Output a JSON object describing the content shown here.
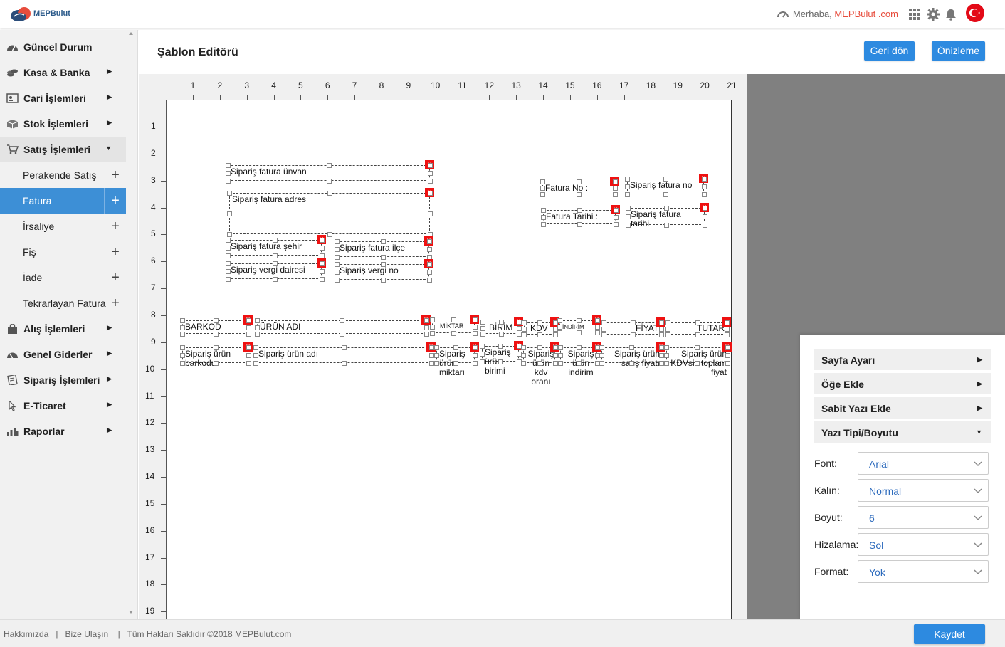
{
  "app": {
    "logo_text": "MEPBulut",
    "greeting": "Merhaba,",
    "user": "MEPBulut .com"
  },
  "sidebar": {
    "items": [
      {
        "label": "Güncel Durum",
        "icon": "dashboard-icon",
        "arrow": ""
      },
      {
        "label": "Kasa & Banka",
        "icon": "coins-icon",
        "arrow": "▶"
      },
      {
        "label": "Cari İşlemleri",
        "icon": "contact-card-icon",
        "arrow": "▶"
      },
      {
        "label": "Stok İşlemleri",
        "icon": "box-icon",
        "arrow": "▶"
      },
      {
        "label": "Satış İşlemleri",
        "icon": "cart-icon",
        "arrow": "▼"
      }
    ],
    "sub_items": [
      {
        "label": "Perakende Satış",
        "plus": "+"
      },
      {
        "label": "Fatura",
        "plus": "+"
      },
      {
        "label": "İrsaliye",
        "plus": "+"
      },
      {
        "label": "Fiş",
        "plus": "+"
      },
      {
        "label": "İade",
        "plus": "+"
      },
      {
        "label": "Tekrarlayan Fatura",
        "plus": "+"
      }
    ],
    "items2": [
      {
        "label": "Alış İşlemleri",
        "icon": "bag-icon",
        "arrow": "▶"
      },
      {
        "label": "Genel Giderler",
        "icon": "gauge-icon",
        "arrow": "▶"
      },
      {
        "label": "Sipariş İşlemleri",
        "icon": "document-icon",
        "arrow": "▶"
      },
      {
        "label": "E-Ticaret",
        "icon": "cursor-icon",
        "arrow": "▶"
      },
      {
        "label": "Raporlar",
        "icon": "bar-chart-icon",
        "arrow": "▶"
      }
    ]
  },
  "header": {
    "title": "Şablon Editörü",
    "back_label": "Geri dön",
    "preview_label": "Önizleme"
  },
  "ruler": {
    "top": [
      "1",
      "2",
      "3",
      "4",
      "5",
      "6",
      "7",
      "8",
      "9",
      "10",
      "11",
      "12",
      "13",
      "14",
      "15",
      "16",
      "17",
      "18",
      "19",
      "20",
      "21"
    ],
    "left": [
      "1",
      "2",
      "3",
      "4",
      "5",
      "6",
      "7",
      "8",
      "9",
      "10",
      "11",
      "12",
      "13",
      "14",
      "15",
      "16",
      "17",
      "18",
      "19"
    ]
  },
  "fields": {
    "unvan": "Sipariş fatura ünvan",
    "adres": "Sipariş fatura adres",
    "sehir": "Sipariş fatura şehir",
    "ilce": "Sipariş fatura ilçe",
    "vergi_dairesi": "Sipariş vergi dairesi",
    "vergi_no": "Sipariş vergi no",
    "fatura_no_label": "Fatura No :",
    "fatura_no": "Sipariş fatura no",
    "fatura_tarihi_label": "Fatura Tarihi :",
    "fatura_tarihi": "Sipariş fatura tarihi",
    "barkod": "BARKOD",
    "urun_adi": "ÜRÜN ADI",
    "miktar": "MİKTAR",
    "birim": "BİRİM",
    "kdv": "KDV",
    "indirim": "İNDİRİM",
    "fiyat": "FİYAT",
    "tutar": "TUTAR",
    "urun_barkodu": "Sipariş ürün barkodu",
    "urun_adi_val": "Sipariş ürün adı",
    "urun_miktari": "Sipariş ürün miktarı",
    "urun_birimi": "Sipariş ürün birimi",
    "urun_kdv": "Sipariş ürün kdv oranı",
    "urun_indirim": "Sipariş ürün indirim",
    "urun_fiyat": "Sipariş ürün satış fiyatı",
    "urun_toplam": "Sipariş ürün KDVsiz toplam fiyat",
    "delete": "x"
  },
  "panel": {
    "sections": [
      {
        "label": "Sayfa Ayarı",
        "arrow": "▶"
      },
      {
        "label": "Öğe Ekle",
        "arrow": "▶"
      },
      {
        "label": "Sabit Yazı Ekle",
        "arrow": "▶"
      },
      {
        "label": "Yazı Tipi/Boyutu",
        "arrow": "▼"
      }
    ],
    "font_label": "Font:",
    "font_value": "Arial",
    "bold_label": "Kalın:",
    "bold_value": "Normal",
    "size_label": "Boyut:",
    "size_value": "6",
    "align_label": "Hizalama:",
    "align_value": "Sol",
    "format_label": "Format:",
    "format_value": "Yok"
  },
  "footer": {
    "about": "Hakkımızda",
    "contact": "Bize Ulaşın",
    "copyright": "Tüm Hakları Saklıdır ©2018 MEPBulut.com",
    "sep": "|",
    "save_label": "Kaydet"
  },
  "colors": {
    "accent": "#2d8ae0",
    "active_menu": "#3d8fd6",
    "delete": "#e11111",
    "user": "#e74c3c"
  }
}
